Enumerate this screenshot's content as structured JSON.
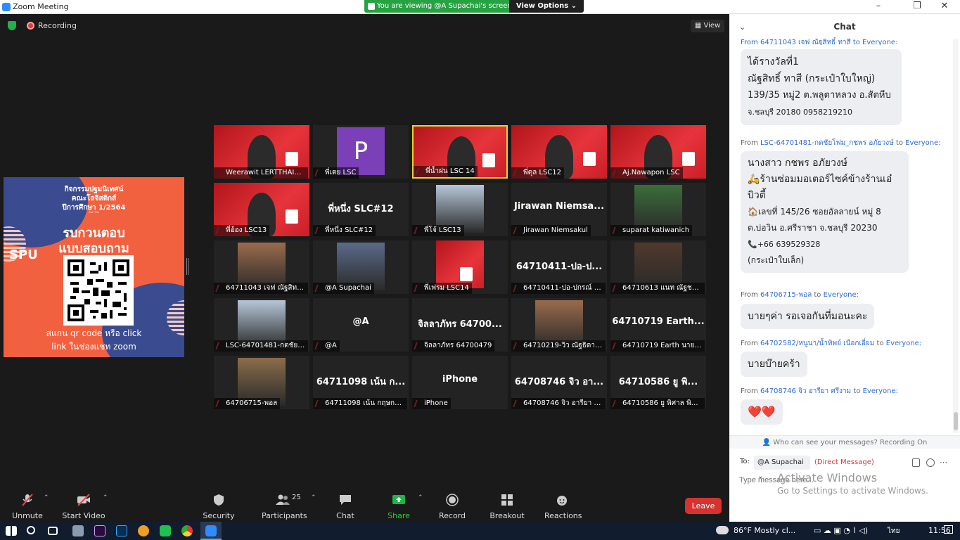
{
  "window": {
    "title": "Zoom Meeting",
    "minimize": "–",
    "maximize": "❐",
    "close": "✕"
  },
  "banner": {
    "viewing": "You are viewing @A Supachai's screen",
    "view_options": "View Options ⌄"
  },
  "meeting": {
    "recording": "Recording",
    "view_label": "View"
  },
  "shared_screen": {
    "line1": "กิจกรรมปฐมนิเทศน์",
    "line2": "คณะโลจิสติกส์",
    "line3": "ปีการศึกษา 1/2564",
    "line4": "~~",
    "title1": "รบกวนตอบ",
    "title2": "แบบสอบถาม",
    "logo": "SPU",
    "cta1": "สแกน qr code หรือ click",
    "cta2": "link ในช่องแชท zoom"
  },
  "participants": [
    {
      "label": "Weerawit LERTTHAITRAK...",
      "kind": "banner",
      "muted": false,
      "active": false
    },
    {
      "label": "พี่เตย LSC",
      "kind": "avatar",
      "avatar_letter": "P",
      "avatar_color": "#7b3fb8",
      "muted": true,
      "active": false
    },
    {
      "label": "พี่น้ำฝน LSC 14",
      "kind": "banner",
      "muted": true,
      "active": true
    },
    {
      "label": "พี่ตุล LSC12",
      "kind": "banner",
      "muted": true,
      "active": false
    },
    {
      "label": "Aj.Nawapon LSC",
      "kind": "banner",
      "muted": true,
      "active": false
    },
    {
      "label": "พี่อ้อง LSC13",
      "kind": "banner",
      "muted": true,
      "active": false
    },
    {
      "label": "พี่หนึ่ง SLC#12",
      "kind": "name",
      "big": "พี่หนึ่ง SLC#12",
      "muted": true,
      "active": false
    },
    {
      "label": "พี่โจ้ LSC13",
      "kind": "photo",
      "muted": true,
      "active": false
    },
    {
      "label": "Jirawan Niemsakul",
      "kind": "name",
      "big": "Jirawan  Niemsa...",
      "muted": true,
      "active": false
    },
    {
      "label": "suparat katiwanich",
      "kind": "photo",
      "muted": true,
      "active": false
    },
    {
      "label": "64711043 เจฟ ณัฐสิทธิ์...",
      "kind": "photo",
      "muted": true,
      "active": false
    },
    {
      "label": "@A Supachai",
      "kind": "photo",
      "muted": true,
      "active": false
    },
    {
      "label": "พี่เฟรม LSC14",
      "kind": "banner-small",
      "muted": true,
      "active": false
    },
    {
      "label": "64710411-ปอ-ปกรณ์ ก...",
      "kind": "name",
      "big": "64710411-ปอ-ป...",
      "muted": true,
      "active": false
    },
    {
      "label": "64710613 แนท ณัฐชา เ...",
      "kind": "photo",
      "muted": true,
      "active": false
    },
    {
      "label": "LSC-64701481-กตชัยโ...",
      "kind": "photo",
      "muted": true,
      "active": false
    },
    {
      "label": "@A",
      "kind": "name",
      "big": "@A",
      "muted": true,
      "active": false
    },
    {
      "label": "จิลลาภัทร 64700479",
      "kind": "name",
      "big": "จิลลาภัทร 64700...",
      "muted": true,
      "active": false
    },
    {
      "label": "64710219-วิว ณัฐธิดา ...",
      "kind": "photo",
      "muted": true,
      "active": false
    },
    {
      "label": "64710719 Earth นายสุ...",
      "kind": "name",
      "big": "64710719  Earth...",
      "muted": true,
      "active": false
    },
    {
      "label": "64706715-พอล",
      "kind": "photo",
      "muted": true,
      "active": false
    },
    {
      "label": "64711098 เน้น กฤษกร ศาล...",
      "kind": "name",
      "big": "64711098 เน้น ก...",
      "muted": true,
      "active": false
    },
    {
      "label": "iPhone",
      "kind": "name",
      "big": "iPhone",
      "muted": true,
      "active": false
    },
    {
      "label": "64708746 จิว อารียา ศรี...",
      "kind": "name",
      "big": "64708746 จิว อา...",
      "muted": true,
      "active": false
    },
    {
      "label": "64710586 ยู  พิศาล พิมพ์...",
      "kind": "name",
      "big": "64710586  ยู   พิ...",
      "muted": true,
      "active": false
    }
  ],
  "toolbar": {
    "unmute": "Unmute",
    "start_video": "Start Video",
    "security": "Security",
    "participants": "Participants",
    "participant_count": "25",
    "chat": "Chat",
    "share_screen": "Share Screen",
    "record": "Record",
    "breakout": "Breakout Rooms",
    "reactions": "Reactions",
    "leave": "Leave"
  },
  "chat": {
    "title": "Chat",
    "from_prefix": "From",
    "to_word": "to",
    "everyone": "Everyone:",
    "top_cut": "From 64711043 เจฟ ณัฐสิทธิ์ ทาสี to Everyone:",
    "msg1": {
      "l1": "ได้รางวัลที่1",
      "l2": "ณัฐสิทธิ์ ทาสี (กระเป๋าใบใหญ่)",
      "l3": "139/35 หมู่2 ต.พลูตาหลวง อ.สัตหีบ",
      "l4": "จ.ชลบุรี 20180 0958219210"
    },
    "from2": "LSC-64701481-กตชัยโฟม_กชพร อภัยวงษ์",
    "msg2": {
      "l1": "นางสาว กชพร อภัยวงษ์",
      "l2": "🛵ร้านซ่อมมอเตอร์ไซค์ข้างร้านเอ๋",
      "l3": "บิวตี้",
      "l4": "🏠เลขที่ 145/26 ซอยอัลลายน์ หมู่ 8",
      "l5": "ต.บ่อวิน อ.ศรีราชา จ.ชลบุรี 20230",
      "l6": "📞+66 639529328",
      "l7": "(กระเป๋าใบเล็ก)"
    },
    "from3": "64706715-พอล",
    "msg3": "บายๆค่า  รอเจอกันที่มอนะคะ",
    "from4": "64702582/หนูนา/น้ำทิพย์ เนือกเอี่ยม",
    "msg4": "บายบ๊ายคร้า",
    "from5": "64708746 จิว อารียา ศรีงาม",
    "msg5": "❤️❤️",
    "who_can_see": "Who can see your messages? Recording On",
    "to_label": "To:",
    "to_value": "@A Supachai ⌄",
    "direct": "(Direct Message)",
    "placeholder": "Type message here...",
    "watermark1": "Activate Windows",
    "watermark2": "Go to Settings to activate Windows."
  },
  "taskbar": {
    "weather": "86°F  Mostly cl...",
    "language": "ไทย",
    "time": "11:56"
  }
}
